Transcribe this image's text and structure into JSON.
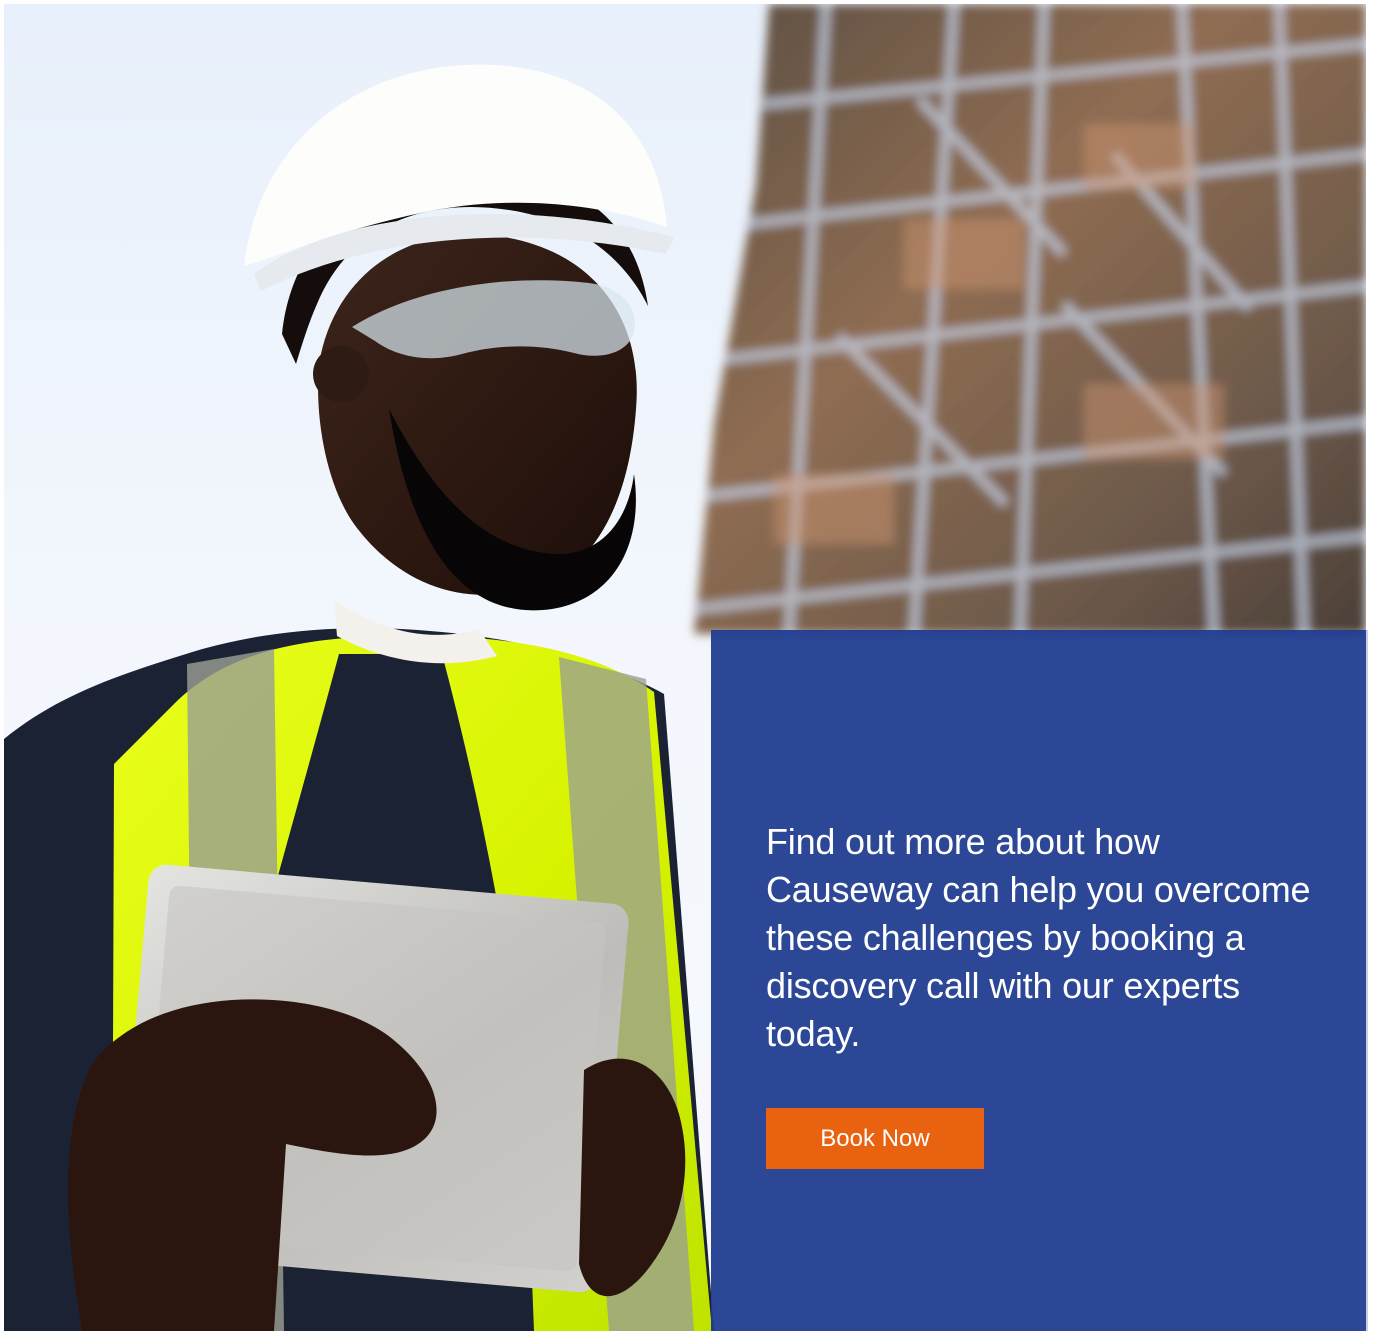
{
  "hero": {
    "image_name": "construction-worker-with-tablet-photo"
  },
  "cta": {
    "message": "Find out more about how Causeway can help you overcome these challenges by booking a discovery call with our experts today.",
    "button_label": "Book Now"
  },
  "colors": {
    "panel": "#203b91",
    "button": "#e8620f",
    "text": "#ffffff"
  }
}
